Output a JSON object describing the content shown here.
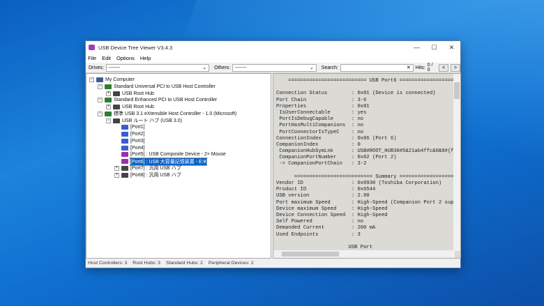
{
  "window": {
    "title": "USB Device Tree Viewer V3.4.3",
    "minimize": "—",
    "maximize": "☐",
    "close": "✕"
  },
  "menu": [
    "File",
    "Edit",
    "Options",
    "Help"
  ],
  "toolbar": {
    "drives_label": "Drives:",
    "drives_value": "-------",
    "others_label": "Others:",
    "others_value": "-------",
    "search_label": "Search:",
    "search_value": "",
    "clear": "✕",
    "hits_label": "Hits:",
    "hits_value": "0 / 0",
    "prev": "<",
    "next": ">"
  },
  "tree": [
    {
      "level": 0,
      "exp": "−",
      "icon": "computer",
      "label": "My Computer"
    },
    {
      "level": 1,
      "exp": "−",
      "icon": "controller",
      "label": "Standard Universal PCI to USB Host Controller"
    },
    {
      "level": 2,
      "exp": "+",
      "icon": "hub",
      "label": "USB Root Hub"
    },
    {
      "level": 1,
      "exp": "−",
      "icon": "controller",
      "label": "Standard Enhanced PCI to USB Host Controller"
    },
    {
      "level": 2,
      "exp": "+",
      "icon": "hub",
      "label": "USB Root Hub"
    },
    {
      "level": 1,
      "exp": "−",
      "icon": "controller",
      "label": "標準 USB 3.1 eXtensible Host Controller - 1.0 (Microsoft)"
    },
    {
      "level": 2,
      "exp": "−",
      "icon": "hub",
      "label": "USB ルート ハブ (USB 3.0)"
    },
    {
      "level": 3,
      "exp": "",
      "icon": "port",
      "label": "[Port1]"
    },
    {
      "level": 3,
      "exp": "",
      "icon": "port",
      "label": "[Port2]"
    },
    {
      "level": 3,
      "exp": "",
      "icon": "port",
      "label": "[Port3]"
    },
    {
      "level": 3,
      "exp": "",
      "icon": "port",
      "label": "[Port4]"
    },
    {
      "level": 3,
      "exp": "",
      "icon": "device",
      "label": "[Port5] : USB Composite Device - 2× Mouse"
    },
    {
      "level": 3,
      "exp": "",
      "icon": "device",
      "label": "[Port6] : USB 大容量記憶装置 - E:¥",
      "selected": true
    },
    {
      "level": 3,
      "exp": "+",
      "icon": "hub",
      "label": "[Port7] : 汎用 USB ハブ"
    },
    {
      "level": 3,
      "exp": "+",
      "icon": "hub",
      "label": "[Port8] : 汎用 USB ハブ"
    }
  ],
  "details": [
    "    ========================== USB Port6 ==================",
    "",
    "Connection Status        : 0x01 (Device is connected)",
    "Port Chain               : 3-6",
    "Properties               : 0x01",
    " IsUserConnectable       : yes",
    " PortIsDebugCapable      : no",
    " PortHasMultiCompanions  : no",
    " PortConnectorIsTypeC    : no",
    "ConnectionIndex          : 0x06 (Port 6)",
    "CompanionIndex           : 0",
    " CompanionHubSymLnk      : USB#ROOT_HUB30#5&21ab4ffc&0&0#{f1",
    " CompanionPortNumber     : 0x02 (Port 2)",
    " -> CompanionPortChain   : 3-2",
    "",
    "      ========================== Summary ==================",
    "Vendor ID                : 0x0930 (Toshiba Corporation)",
    "Product ID               : 0x6544",
    "USB version              : 2.00",
    "Port maximum Speed       : High-Speed (Companion Port 2 supp",
    "Device maximum Speed     : High-Speed",
    "Device Connection Speed  : High-Speed",
    "Self Powered             : no",
    "Demanded Current         : 200 mA",
    "Used Endpoints           : 3",
    "",
    "                        USB Port"
  ],
  "status": [
    "Host Controllers: 3",
    "Root Hubs: 3",
    "Standard Hubs: 2",
    "Peripheral Devices: 2"
  ],
  "colors": {
    "selection": "#0a64c8",
    "controller": "#2e7d32",
    "hub": "#444444",
    "port": "#3a5fcd",
    "device": "#9b2fae",
    "computer": "#3d5a99"
  }
}
